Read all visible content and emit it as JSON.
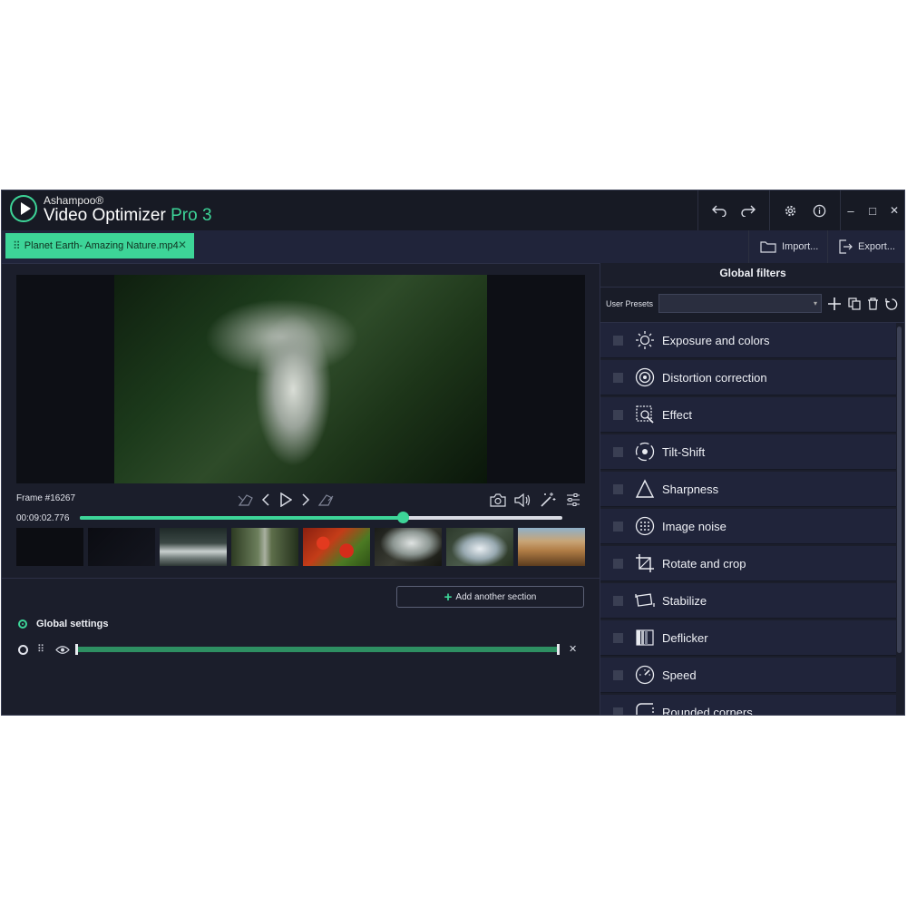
{
  "app": {
    "brand_small": "Ashampoo®",
    "brand_main": "Video Optimizer",
    "brand_pro": "Pro 3"
  },
  "titlebar": {
    "undo_icon": "undo-icon",
    "redo_icon": "redo-icon",
    "settings_icon": "gear-icon",
    "info_icon": "info-icon",
    "minimize": "–",
    "maximize": "□",
    "close": "✕"
  },
  "tabs": {
    "file_tab": "Planet Earth- Amazing Nature.mp4",
    "close_glyph": "✕",
    "import_label": "Import...",
    "export_label": "Export..."
  },
  "player": {
    "frame_label": "Frame #16267",
    "time_label": "00:09:02.776",
    "position_fraction": 0.67
  },
  "sections": {
    "add_label": "Add another section",
    "global_label": "Global settings",
    "close_glyph": "✕"
  },
  "panel": {
    "title": "Global filters",
    "presets_label": "User Presets",
    "presets_value": "",
    "filters": [
      {
        "label": "Exposure and colors",
        "icon": "sun-icon"
      },
      {
        "label": "Distortion correction",
        "icon": "lens-icon"
      },
      {
        "label": "Effect",
        "icon": "effect-icon"
      },
      {
        "label": "Tilt-Shift",
        "icon": "tilt-shift-icon"
      },
      {
        "label": "Sharpness",
        "icon": "triangle-icon"
      },
      {
        "label": "Image noise",
        "icon": "noise-icon"
      },
      {
        "label": "Rotate and crop",
        "icon": "crop-icon"
      },
      {
        "label": "Stabilize",
        "icon": "stabilize-icon"
      },
      {
        "label": "Deflicker",
        "icon": "deflicker-icon"
      },
      {
        "label": "Speed",
        "icon": "speedometer-icon"
      },
      {
        "label": "Rounded corners",
        "icon": "rounded-corners-icon"
      }
    ]
  },
  "colors": {
    "accent": "#3dd598",
    "background": "#1b1e2b",
    "panel_row": "#20243a"
  }
}
